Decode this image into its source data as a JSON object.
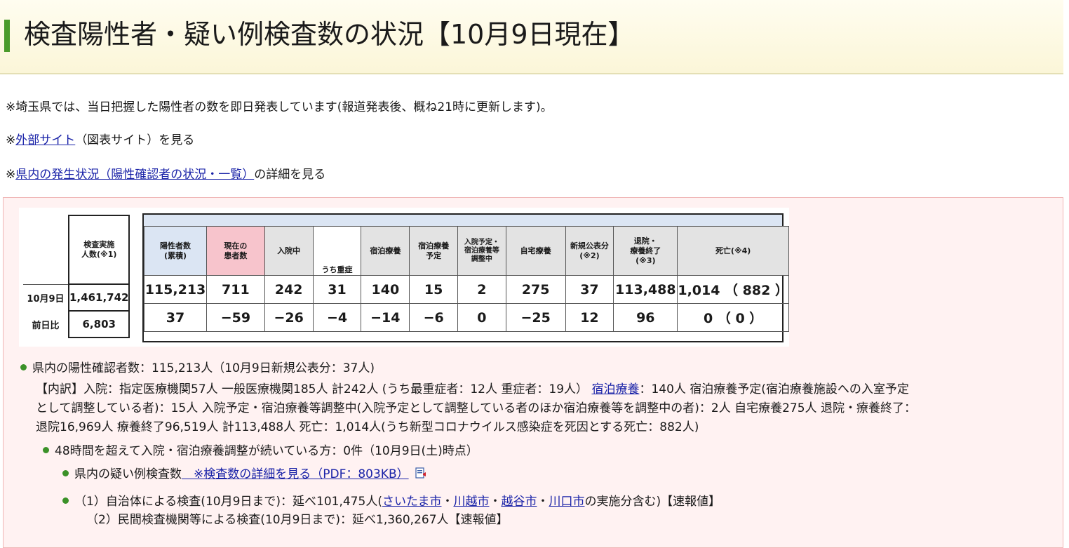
{
  "header": {
    "title": "検査陽性者・疑い例検査数の状況【10月9日現在】"
  },
  "notes": {
    "line1": "※埼玉県では、当日把握した陽性者の数を即日発表しています(報道発表後、概ね21時に更新します)。",
    "line2_prefix": "※",
    "line2_link": "外部サイト",
    "line2_suffix": "（図表サイト）を見る",
    "line3_prefix": "※",
    "line3_link": "県内の発生状況（陽性確認者の状況・一覧）",
    "line3_suffix": "の詳細を見る"
  },
  "table": {
    "headers": {
      "tests": "検査実施\n人数(※1)",
      "positives": "陽性者数\n(累積)",
      "current": "現在の\n患者数",
      "hospitalized": "入院中",
      "severe": "うち重症",
      "lodging": "宿泊療養",
      "lodging_planned": "宿泊療養\n予定",
      "adjusting": "入院予定・\n宿泊療養等\n調整中",
      "home": "自宅療養",
      "new_announced": "新規公表分\n(※2)",
      "recovered": "退院・\n療養終了\n(※3)",
      "deaths": "死亡(※4)"
    },
    "rows": [
      {
        "label": "10月9日",
        "tests": "1,461,742",
        "positives": "115,213",
        "current": "711",
        "hospitalized": "242",
        "severe": "31",
        "lodging": "140",
        "lodging_planned": "15",
        "adjusting": "2",
        "home": "275",
        "new_announced": "37",
        "recovered": "113,488",
        "deaths": "1,014 （ 882 ）"
      },
      {
        "label": "前日比",
        "tests": "6,803",
        "positives": "37",
        "current": "−59",
        "hospitalized": "−26",
        "severe": "−4",
        "lodging": "−14",
        "lodging_planned": "−6",
        "adjusting": "0",
        "home": "−25",
        "new_announced": "12",
        "recovered": "96",
        "deaths": "0 （ 0 ）"
      }
    ]
  },
  "summary": {
    "b1": "県内の陽性確認者数：115,213人（10月9日新規公表分：37人)",
    "b1_line2_a": "【内訳】入院：指定医療機関57人 一般医療機関185人 計242人 (うち最重症者：12人 重症者：19人） ",
    "b1_line2_link": "宿泊療養",
    "b1_line2_b": "：140人 宿泊療養予定(宿泊療養施設への入室予定",
    "b1_line3": "として調整している者)：15人 入院予定・宿泊療養等調整中(入院予定として調整している者のほか宿泊療養等を調整中の者)：2人 自宅療養275人 退院・療養終了：",
    "b1_line4": "退院16,969人 療養終了96,519人 計113,488人 死亡：1,014人(うち新型コロナウイルス感染症を死因とする死亡：882人)",
    "b2": "48時間を超えて入院・宿泊療養調整が続いている方：0件（10月9日(土)時点）",
    "b3_text": "県内の疑い例検査数",
    "b3_link": "　※検査数の詳細を見る（PDF：803KB）",
    "b4_a": "（1）自治体による検査(10月9日まで)：延べ101,475人(",
    "b4_link1": "さいたま市",
    "b4_sep1": "・",
    "b4_link2": "川越市",
    "b4_sep2": "・",
    "b4_link3": "越谷市",
    "b4_sep3": "・",
    "b4_link4": "川口市",
    "b4_b": "の実施分含む)【速報値】",
    "b5": "（2）民間検査機関等による検査(10月9日まで)：延べ1,360,267人【速報値】"
  },
  "colors": {
    "accent_green": "#4a9b2a",
    "pink_header": "#f7c4cc",
    "blue_header": "#dbe5f3",
    "link": "#1a23a8"
  }
}
